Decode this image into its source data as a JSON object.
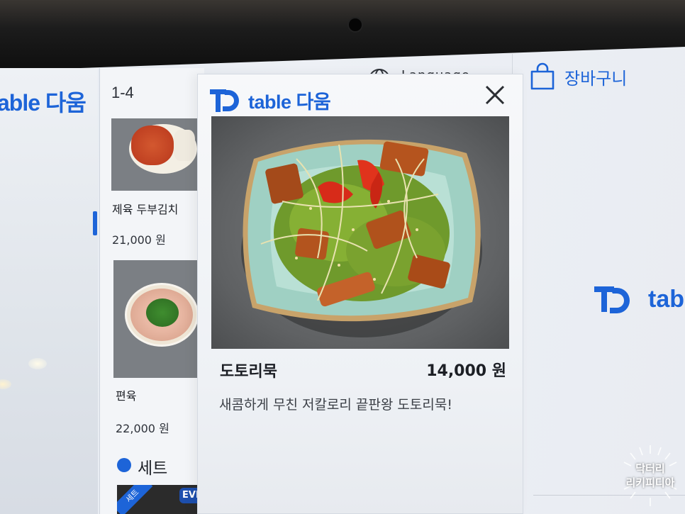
{
  "brand": {
    "left_logo": "able 다움",
    "modal_logo_text": "table 다움",
    "right_logo_text": "tabl"
  },
  "menu_list": {
    "range_label": "1-4",
    "items": [
      {
        "name": "제육 두부김치",
        "price": "21,000 원"
      },
      {
        "name": "편육",
        "price": "22,000 원"
      }
    ],
    "section_label": "세트",
    "set_badges": {
      "set": "세트",
      "event": "EVE"
    }
  },
  "header": {
    "language_label": "Language",
    "cart_label": "장바구니"
  },
  "modal": {
    "dish_name": "도토리묵",
    "dish_price": "14,000 원",
    "dish_description": "새콤하게 무친 저칼로리 끝판왕 도토리묵!"
  },
  "watermark": {
    "line1": "닥터리",
    "line2": "리키피디아"
  },
  "icons": {
    "close": "close-icon",
    "cart": "shopping-bag-icon",
    "globe": "globe-icon"
  },
  "colors": {
    "accent": "#1d64d8",
    "text": "#1c1f25"
  }
}
